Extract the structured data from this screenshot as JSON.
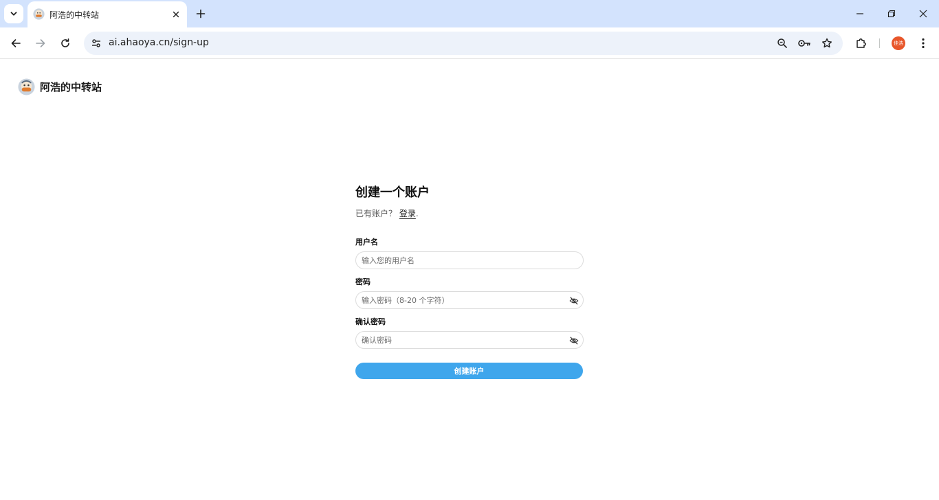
{
  "browser": {
    "tab_title": "阿浩的中转站",
    "url": "ai.ahaoya.cn/sign-up",
    "profile_initials": "佳浩"
  },
  "icons": {
    "tab_search": "chevron-down-icon",
    "tab_close": "close-icon",
    "new_tab": "plus-icon",
    "minimize": "minimize-icon",
    "restore": "restore-icon",
    "close_window": "close-icon",
    "back": "arrow-left-icon",
    "forward": "arrow-right-icon",
    "reload": "reload-icon",
    "site_info": "tune-icon",
    "zoom": "zoom-icon",
    "password": "key-icon",
    "bookmark": "star-icon",
    "extensions": "puzzle-icon",
    "menu": "kebab-menu-icon",
    "password_toggle": "eye-off-icon"
  },
  "site": {
    "brand_name": "阿浩的中转站"
  },
  "form": {
    "title": "创建一个账户",
    "have_account": "已有账户？",
    "login_link": "登录",
    "login_suffix": ".",
    "username": {
      "label": "用户名",
      "placeholder": "输入您的用户名"
    },
    "password": {
      "label": "密码",
      "placeholder": "输入密码（8-20 个字符）"
    },
    "confirm_password": {
      "label": "确认密码",
      "placeholder": "确认密码"
    },
    "submit_label": "创建账户"
  },
  "colors": {
    "tab_strip": "#d3e3fd",
    "omnibox": "#edf2fa",
    "primary_button": "#3fa6ec",
    "profile": "#e8562a"
  }
}
